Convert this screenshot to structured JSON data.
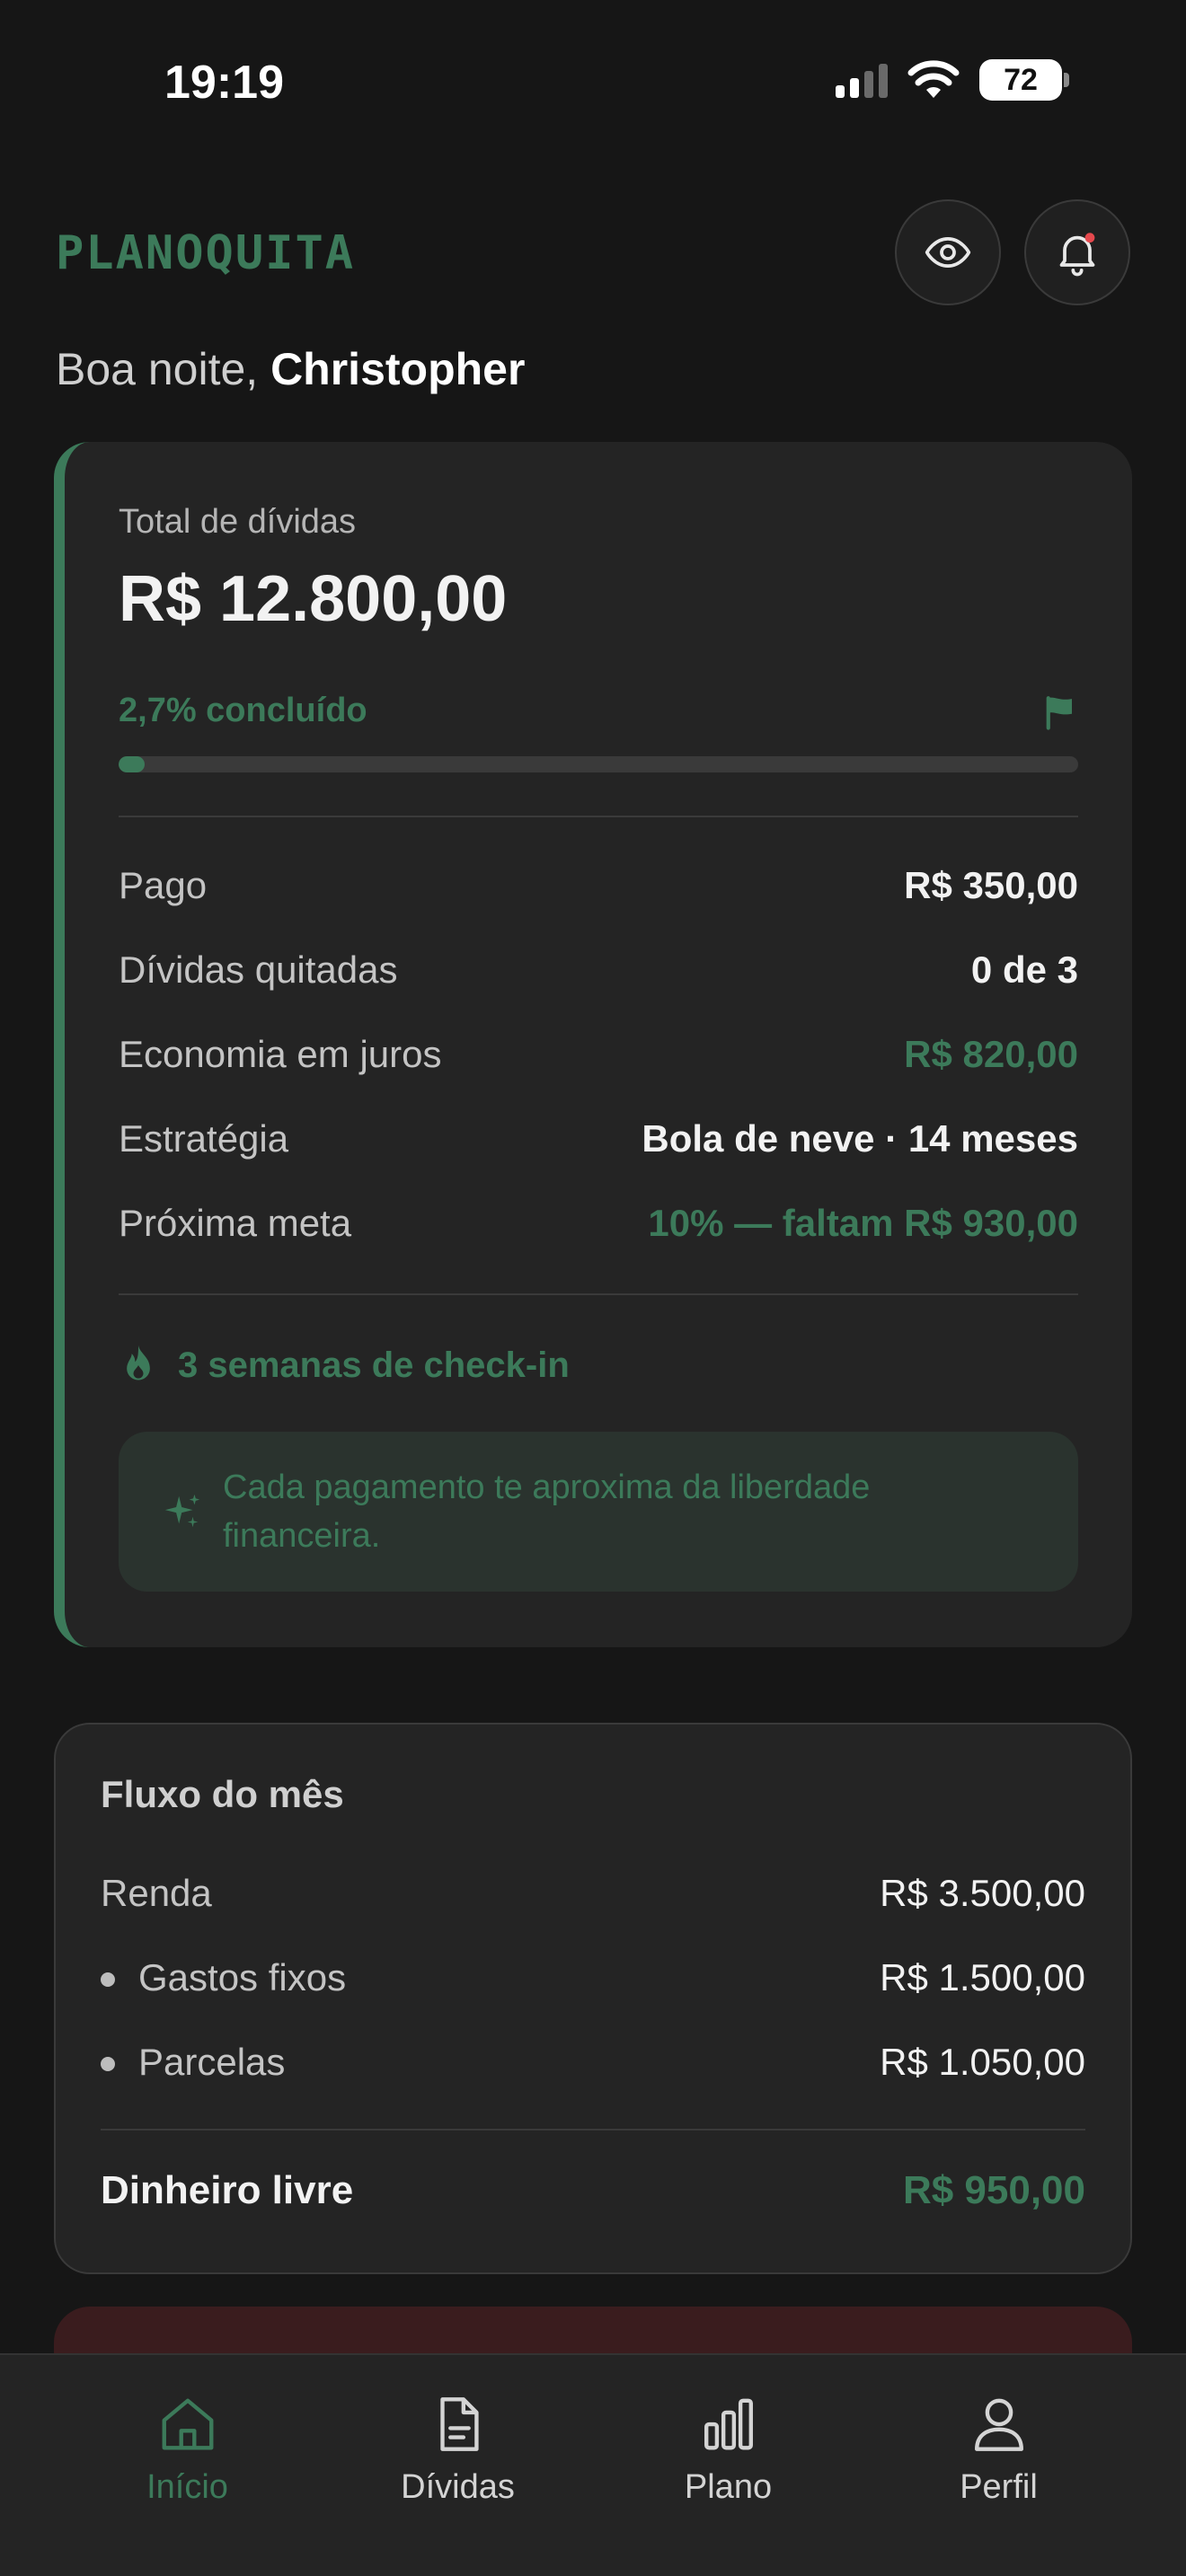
{
  "status_bar": {
    "time": "19:19",
    "battery": "72"
  },
  "header": {
    "logo": "PLANOQUITA",
    "greeting_prefix": "Boa noite,",
    "user_name": "Christopher"
  },
  "summary": {
    "total_label": "Total de dívidas",
    "total_value": "R$ 12.800,00",
    "progress_label": "2,7% concluído",
    "progress_fraction": 0.027,
    "rows": [
      {
        "label": "Pago",
        "value": "R$ 350,00",
        "accent": false
      },
      {
        "label": "Dívidas quitadas",
        "value": "0 de 3",
        "accent": false
      },
      {
        "label": "Economia em juros",
        "value": "R$ 820,00",
        "accent": true
      },
      {
        "label": "Estratégia",
        "value": "Bola de neve · 14 meses",
        "accent": false
      },
      {
        "label": "Próxima meta",
        "value": "10% — faltam R$ 930,00",
        "accent": true
      }
    ],
    "streak": "3 semanas de check-in",
    "motivation": "Cada pagamento te aproxima da liberdade financeira."
  },
  "flow": {
    "title": "Fluxo do mês",
    "income_label": "Renda",
    "income_value": "R$ 3.500,00",
    "items": [
      {
        "label": "Gastos fixos",
        "value": "R$ 1.500,00"
      },
      {
        "label": "Parcelas",
        "value": "R$ 1.050,00"
      }
    ],
    "free_label": "Dinheiro livre",
    "free_value": "R$ 950,00"
  },
  "nav": [
    {
      "label": "Início",
      "icon": "home-icon",
      "active": true
    },
    {
      "label": "Dívidas",
      "icon": "document-icon",
      "active": false
    },
    {
      "label": "Plano",
      "icon": "bar-chart-icon",
      "active": false
    },
    {
      "label": "Perfil",
      "icon": "user-icon",
      "active": false
    }
  ],
  "colors": {
    "accent": "#3c7a5a",
    "background": "#161616",
    "card": "#242424",
    "alert": "#3a1c1e",
    "notification_dot": "#e5484d"
  }
}
